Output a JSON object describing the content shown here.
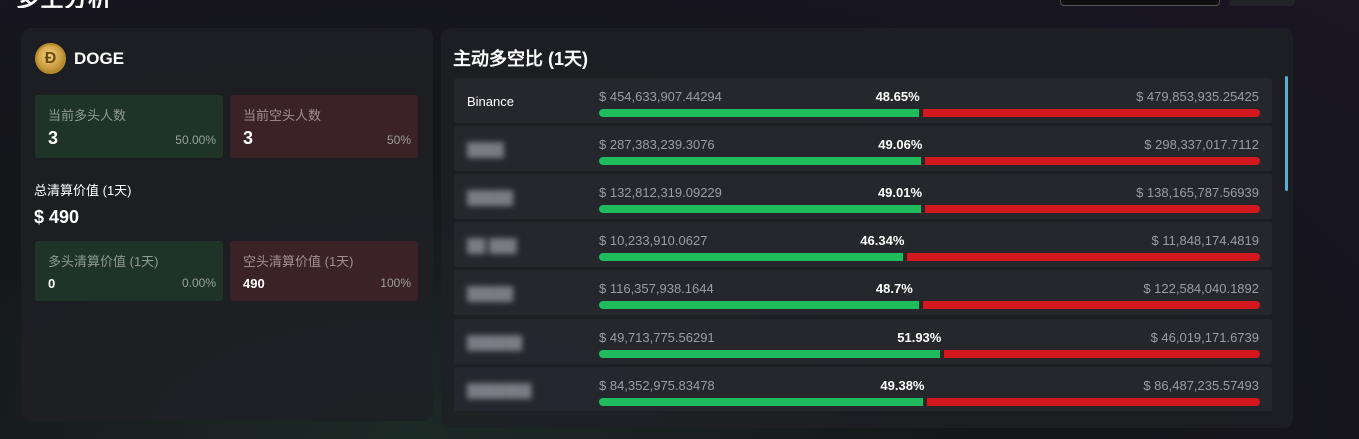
{
  "header": {
    "title": "多空分析"
  },
  "coin": {
    "symbol": "DOGE",
    "logo_icon": "doge-coin-icon"
  },
  "current": {
    "long_label": "当前多头人数",
    "long_value": "3",
    "long_pct": "50.00%",
    "short_label": "当前空头人数",
    "short_value": "3",
    "short_pct": "50%"
  },
  "liquidation": {
    "total_label": "总清算价值 (1天)",
    "total_value": "$ 490",
    "long_label": "多头清算价值 (1天)",
    "long_value": "0",
    "long_pct": "0.00%",
    "short_label": "空头清算价值 (1天)",
    "short_value": "490",
    "short_pct": "100%"
  },
  "ratio": {
    "title": "主动多空比 (1天)",
    "colors": {
      "long": "#1fbb5c",
      "short": "#d3181e",
      "scroll": "#4fb3d6"
    },
    "rows": [
      {
        "exchange": "Binance",
        "blurred": false,
        "long_value": "$ 454,633,907.44294",
        "long_pct": "48.65%",
        "short_value": "$ 479,853,935.25425",
        "fraction": 0.4865
      },
      {
        "exchange": "████",
        "blurred": true,
        "long_value": "$ 287,383,239.3076",
        "long_pct": "49.06%",
        "short_value": "$ 298,337,017.7112",
        "fraction": 0.4906
      },
      {
        "exchange": "█████",
        "blurred": true,
        "long_value": "$ 132,812,319.09229",
        "long_pct": "49.01%",
        "short_value": "$ 138,165,787.56939",
        "fraction": 0.4901
      },
      {
        "exchange": "██ ███",
        "blurred": true,
        "long_value": "$ 10,233,910.0627",
        "long_pct": "46.34%",
        "short_value": "$ 11,848,174.4819",
        "fraction": 0.4634
      },
      {
        "exchange": "█████",
        "blurred": true,
        "long_value": "$ 116,357,938.1644",
        "long_pct": "48.7%",
        "short_value": "$ 122,584,040.1892",
        "fraction": 0.487
      },
      {
        "exchange": "██████",
        "blurred": true,
        "long_value": "$ 49,713,775.56291",
        "long_pct": "51.93%",
        "short_value": "$ 46,019,171.6739",
        "fraction": 0.5193
      },
      {
        "exchange": "███████",
        "blurred": true,
        "long_value": "$ 84,352,975.83478",
        "long_pct": "49.38%",
        "short_value": "$ 86,487,235.57493",
        "fraction": 0.4938
      }
    ]
  }
}
